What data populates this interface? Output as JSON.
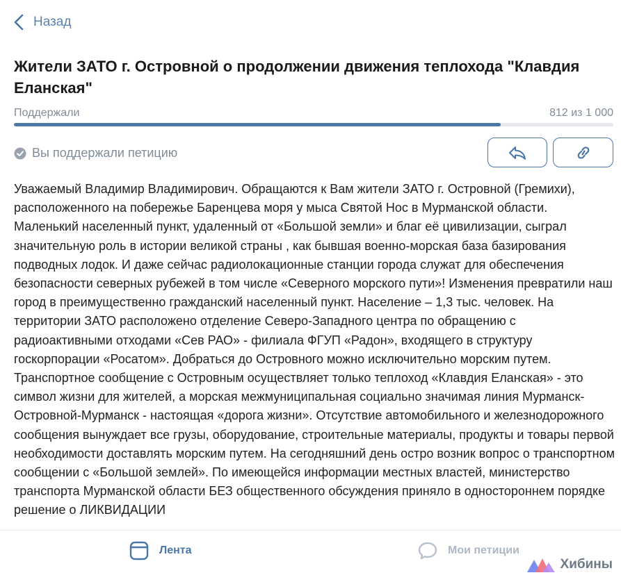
{
  "nav": {
    "back_label": "Назад"
  },
  "petition": {
    "title": "Жители ЗАТО г. Островной о продолжении движения теплохода \"Клавдия Еланская\"",
    "progress_label": "Поддержали",
    "progress_count": "812 из 1 000",
    "progress_fraction": 0.812,
    "supported_status": "Вы поддержали петицию",
    "body": "Уважаемый Владимир Владимирович. Обращаются к Вам жители ЗАТО г. Островной (Гремихи), расположенного на побережье Баренцева моря у мыса Святой Нос в Мурманской области. Маленький населенный пункт, удаленный от «Большой земли» и благ её цивилизации, сыграл значительную роль в истории великой страны , как бывшая военно-морская база базирования подводных лодок. И даже сейчас радиолокационные станции города служат для обеспечения безопасности северных рубежей в том числе «Северного морского пути»! Изменения превратили наш город в преимущественно гражданский населенный пункт. Население – 1,3 тыс. человек. На территории ЗАТО расположено отделение Северо-Западного центра по обращению с радиоактивными отходами «Сев РАО» - филиала ФГУП «Радон», входящего в структуру госкорпорации «Росатом». Добраться до Островного можно исключительно морским путем. Транспортное сообщение с Островным осуществляет только теплоход «Клавдия Еланская» - это символ жизни для жителей, а морская межмуниципальная социально значимая линия Мурманск-Островной-Мурманск - настоящая «дорога жизни». Отсутствие автомобильного и железнодорожного сообщения вынуждает все грузы, оборудование, строительные материалы, продукты и товары первой необходимости доставлять морским путем. На сегодняшний день остро возник вопрос о транспортном сообщении с «Большой землей». По имеющейся информации местных властей, министерство транспорта Мурманской области БЕЗ общественного обсуждения приняло в одностороннем порядке решение о ЛИКВИДАЦИИ"
  },
  "actions": {
    "share_icon": "share-icon",
    "link_icon": "link-icon"
  },
  "bottom_nav": {
    "feed_label": "Лента",
    "my_petitions_label": "Мои петиции",
    "brand_label": "Хибины"
  },
  "colors": {
    "accent": "#4a76a8",
    "muted": "#818c99",
    "track": "#e7e8ec"
  }
}
